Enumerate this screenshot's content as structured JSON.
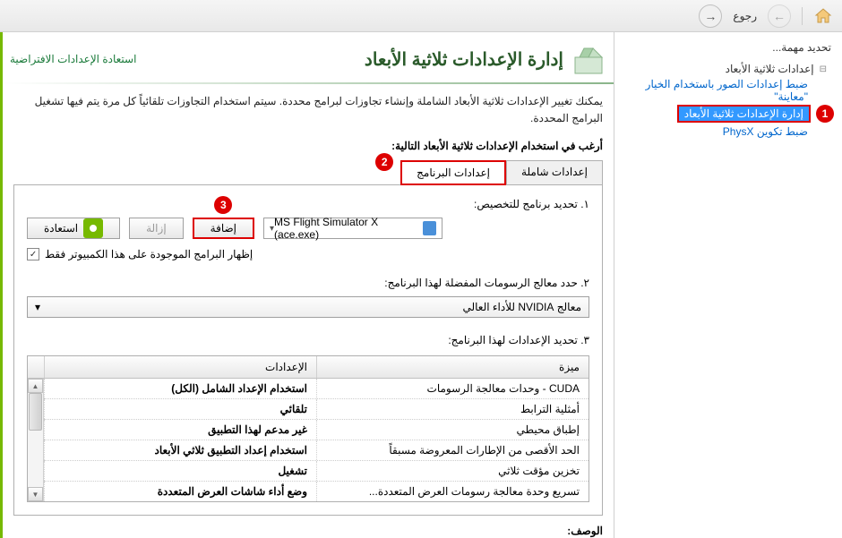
{
  "nav": {
    "back_label": "رجوع"
  },
  "sidebar": {
    "title": "تحديد مهمة...",
    "root": "إعدادات ثلاثية الأبعاد",
    "items": [
      "ضبط إعدادات الصور باستخدام الخيار \"معاينة\"",
      "إدارة الإعدادات ثلاثية الأبعاد",
      "ضبط تكوين PhysX"
    ]
  },
  "content": {
    "title": "إدارة الإعدادات ثلاثية الأبعاد",
    "restore": "استعادة الإعدادات الافتراضية",
    "description": "يمكنك تغيير الإعدادات ثلاثية الأبعاد الشاملة وإنشاء تجاوزات لبرامج محددة. سيتم استخدام التجاوزات تلقائياً كل مرة يتم فيها تشغيل البرامج المحددة.",
    "section_label": "أرغب في استخدام الإعدادات ثلاثية الأبعاد التالية:",
    "tabs": {
      "global": "إعدادات شاملة",
      "program": "إعدادات البرنامج"
    },
    "step1_label": "١. تحديد برنامج للتخصيص:",
    "program_select": "MS Flight Simulator X (ace.exe)",
    "btn_add": "إضافة",
    "btn_remove": "إزالة",
    "btn_restore": "استعادة",
    "checkbox_label": "إظهار البرامج الموجودة على هذا الكمبيوتر فقط",
    "step2_label": "٢. حدد معالج الرسومات المفضلة لهذا البرنامج:",
    "gpu_select": "معالج NVIDIA للأداء العالي",
    "step3_label": "٣. تحديد الإعدادات لهذا البرنامج:",
    "table": {
      "col_feature": "ميزة",
      "col_setting": "الإعدادات",
      "rows": [
        {
          "feature": "CUDA - وحدات معالجة الرسومات",
          "setting": "استخدام الإعداد الشامل (الكل)"
        },
        {
          "feature": "أمثلية الترابط",
          "setting": "تلقائي"
        },
        {
          "feature": "إطباق محيطي",
          "setting": "غير مدعم لهذا التطبيق"
        },
        {
          "feature": "الحد الأقصى من الإطارات المعروضة مسبقاً",
          "setting": "استخدام إعداد التطبيق ثلاثي الأبعاد"
        },
        {
          "feature": "تخزين مؤقت ثلاثي",
          "setting": "تشغيل"
        },
        {
          "feature": "تسريع وحدة معالجة رسومات العرض المتعددة...",
          "setting": "وضع أداء شاشات العرض المتعددة"
        }
      ]
    },
    "footer": "الوصف:"
  },
  "callouts": {
    "one": "1",
    "two": "2",
    "three": "3"
  }
}
